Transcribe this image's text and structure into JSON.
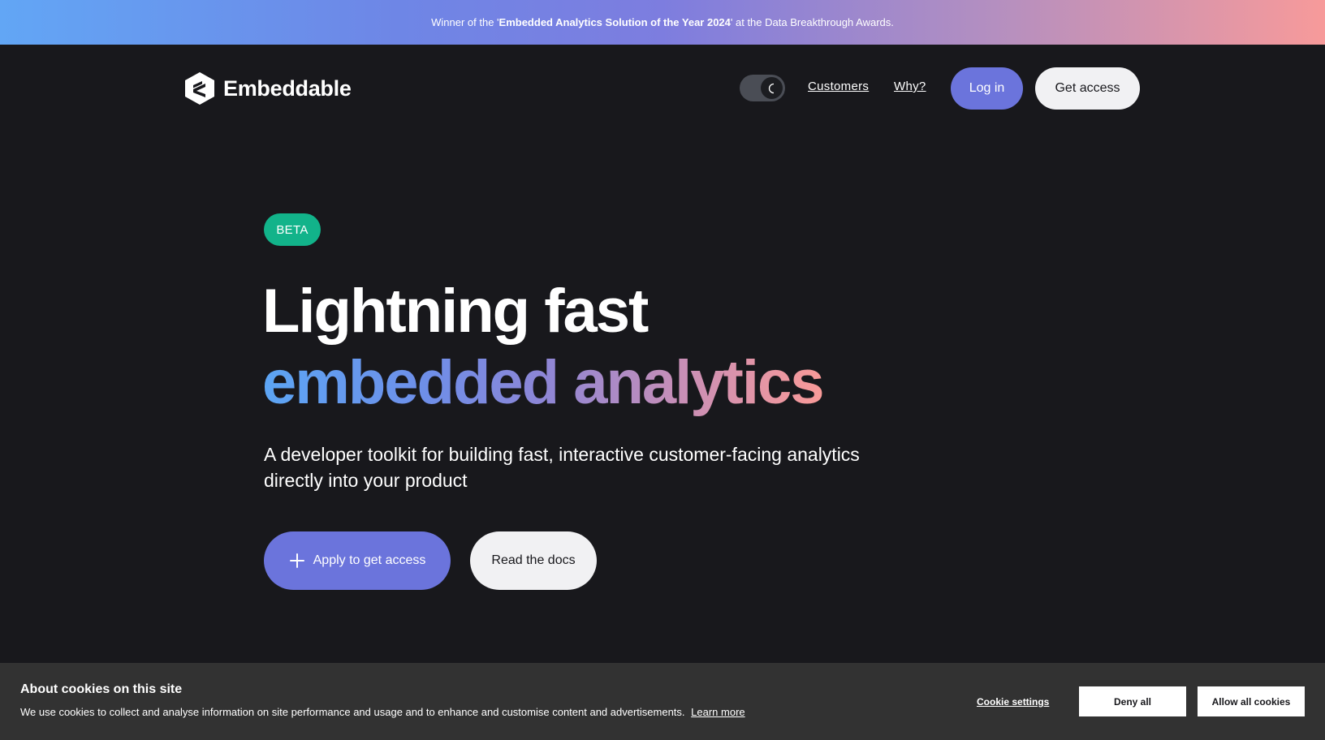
{
  "promo": {
    "prefix": "Winner of the '",
    "highlight": "Embedded Analytics Solution of the Year 2024",
    "suffix": "' at the Data Breakthrough Awards."
  },
  "nav": {
    "logo_text": "Embeddable",
    "links": [
      "Customers",
      "Why?"
    ],
    "login_label": "Log in",
    "get_access_label": "Get access"
  },
  "hero": {
    "badge": "BETA",
    "headline_line1": "Lightning fast",
    "headline_line2": "embedded analytics",
    "subheadline": "A developer toolkit for building fast, interactive customer-facing analytics directly into your product",
    "cta_primary": "Apply to get access",
    "cta_secondary": "Read the docs"
  },
  "cookies": {
    "title": "About cookies on this site",
    "text": "We use cookies to collect and analyse information on site performance and usage and to enhance and customise content and advertisements.",
    "learn_more": "Learn more",
    "settings_label": "Cookie settings",
    "deny_label": "Deny all",
    "allow_label": "Allow all cookies"
  },
  "colors": {
    "background": "#18181c",
    "accent": "#6b74dc",
    "badge": "#12b38a",
    "cookie_bg": "#323232"
  },
  "icons": [
    "embeddable-logo-icon",
    "moon-icon",
    "plus-icon"
  ]
}
